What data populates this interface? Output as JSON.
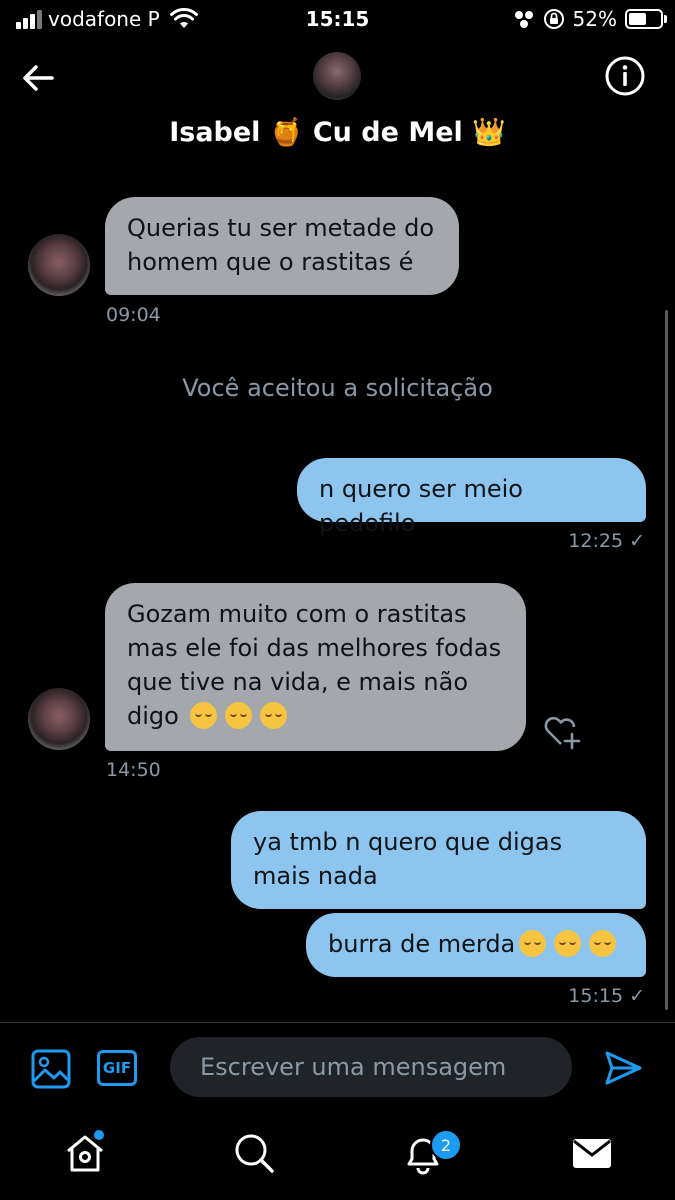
{
  "status_bar": {
    "carrier": "vodafone P",
    "time": "15:15",
    "battery_percent": "52%",
    "battery_level": 0.52
  },
  "header": {
    "title": "Isabel 🍯 Cu de Mel 👑"
  },
  "messages": [
    {
      "direction": "incoming",
      "text": "Querias tu ser metade do homem que o rastitas é",
      "time": "09:04"
    },
    {
      "direction": "system",
      "text": "Você aceitou a solicitação"
    },
    {
      "direction": "outgoing",
      "text": "n quero ser meio pedofilo",
      "time": "12:25 ✓"
    },
    {
      "direction": "incoming",
      "text": "Gozam muito com o rastitas mas ele foi das melhores fodas que tive na vida, e mais não digo",
      "emoji": "😌😌😌",
      "time": "14:50"
    },
    {
      "direction": "outgoing",
      "text": "ya tmb n quero que digas mais nada"
    },
    {
      "direction": "outgoing",
      "text": "burra de merda",
      "emoji": "😂😂😂",
      "time": "15:15 ✓"
    }
  ],
  "composer": {
    "gif_label": "GIF",
    "placeholder": "Escrever uma mensagem"
  },
  "nav": {
    "notifications_badge": "2"
  },
  "colors": {
    "incoming_bubble": "#a4a7ac",
    "outgoing_bubble": "#8ec5ef",
    "accent": "#1d9bf0",
    "muted_text": "#8b98a5"
  }
}
